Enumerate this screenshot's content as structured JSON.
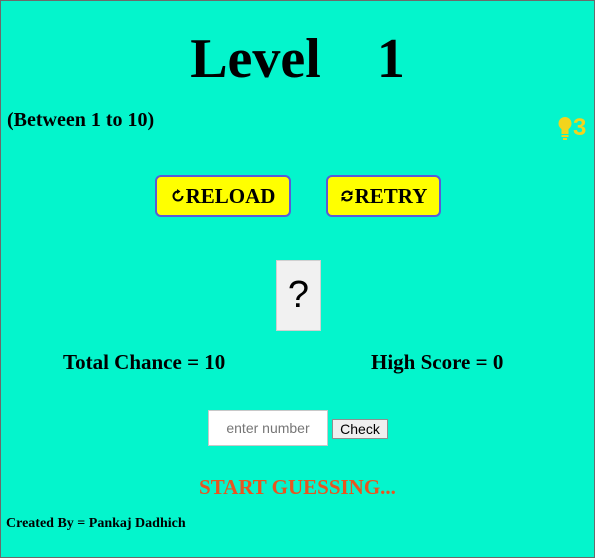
{
  "game": {
    "level_label": "Level",
    "level_number": "1",
    "range_text": "(Between 1 to 10)",
    "hint_count": "3",
    "hint_icon": "lightbulb-icon",
    "reload_label": "RELOAD",
    "reload_icon": "reload-icon",
    "retry_label": "RETRY",
    "retry_icon": "retry-icon",
    "mystery_value": "?",
    "total_chance_text": "Total Chance = 10",
    "high_score_text": "High Score = 0",
    "input_value": "",
    "input_placeholder": "enter number",
    "check_label": "Check",
    "status_text": "START GUESSING...",
    "credit_text": "Created By = Pankaj Dadhich"
  },
  "colors": {
    "background": "#04f5cc",
    "button_fill": "#ffff00",
    "button_border": "#5a5ad8",
    "hint": "#f2d41d",
    "status": "#e8551f"
  }
}
